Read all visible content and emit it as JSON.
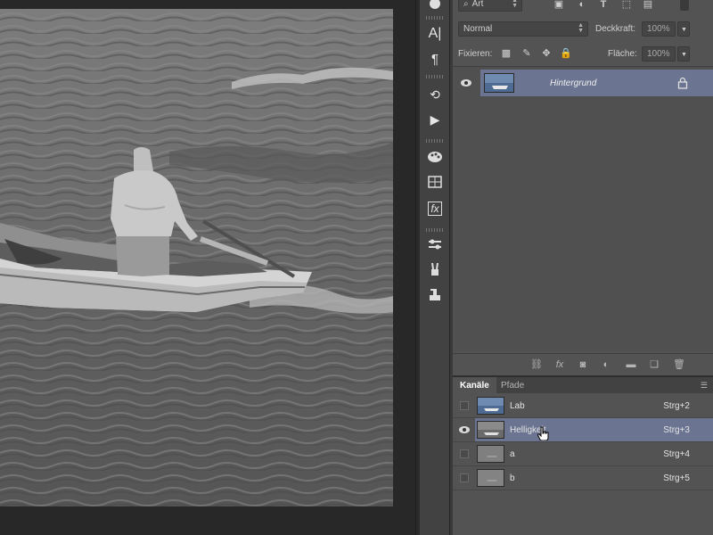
{
  "layers_panel": {
    "filter_kind": "Art",
    "blend_mode": "Normal",
    "opacity_label": "Deckkraft:",
    "opacity_value": "100%",
    "lock_label": "Fixieren:",
    "fill_label": "Fläche:",
    "fill_value": "100%",
    "layers": [
      {
        "name": "Hintergrund",
        "visible": true,
        "locked": true
      }
    ]
  },
  "channels_panel": {
    "tabs": [
      {
        "label": "Kanäle",
        "active": true
      },
      {
        "label": "Pfade",
        "active": false
      }
    ],
    "channels": [
      {
        "name": "Lab",
        "shortcut": "Strg+2",
        "visible": false,
        "selected": false
      },
      {
        "name": "Helligkeit",
        "shortcut": "Strg+3",
        "visible": true,
        "selected": true
      },
      {
        "name": "a",
        "shortcut": "Strg+4",
        "visible": false,
        "selected": false
      },
      {
        "name": "b",
        "shortcut": "Strg+5",
        "visible": false,
        "selected": false
      }
    ]
  },
  "icons": {
    "iconbar": [
      "character-icon",
      "paragraph-icon",
      "history-icon",
      "actions-icon",
      "swatches-icon",
      "styles-icon",
      "adjustments-icon",
      "properties-icon",
      "brush-presets-icon",
      "clone-source-icon"
    ]
  },
  "colors": {
    "panel_bg": "#535353",
    "selection": "#6b7591",
    "canvas_bg": "#282828"
  }
}
